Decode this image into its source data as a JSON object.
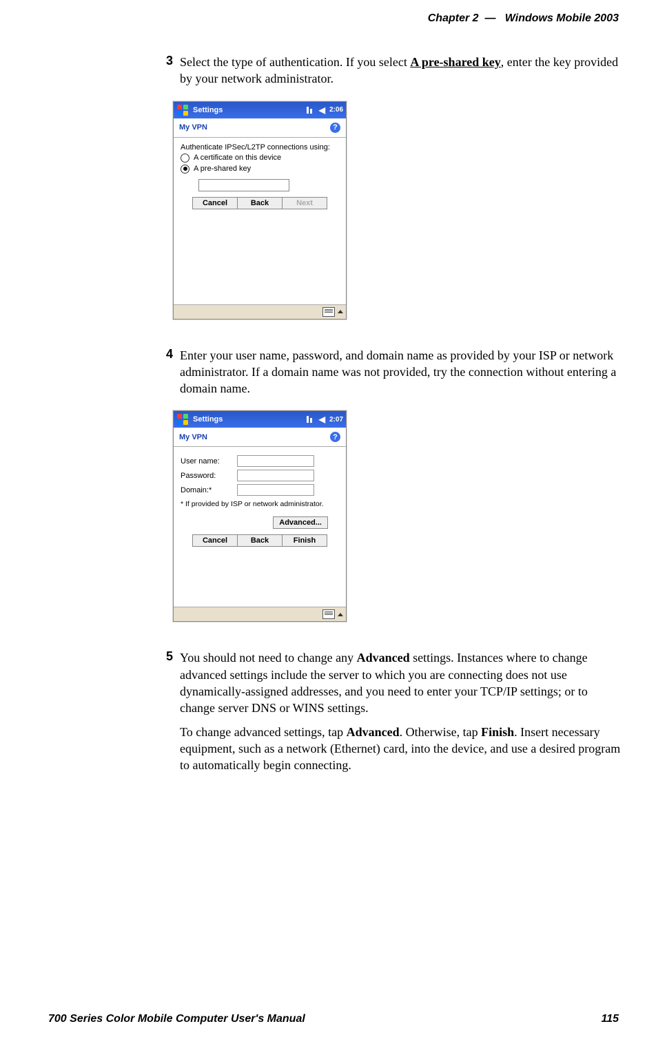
{
  "header": {
    "chapter": "Chapter",
    "chapter_num": "2",
    "dash": "—",
    "title": "Windows Mobile 2003"
  },
  "footer": {
    "manual": "700 Series Color Mobile Computer User's Manual",
    "page": "115"
  },
  "steps": {
    "s3": {
      "num": "3",
      "t1": "Select the type of authentication. If you select ",
      "bu1": "A pre-shared key",
      "t2": ", enter the key provided by your network administrator."
    },
    "s4": {
      "num": "4",
      "t1": "Enter your user name, password, and domain name as provided by your ISP or network administrator. If a domain name was not provided, try the connection without entering a domain name."
    },
    "s5": {
      "num": "5",
      "p1a": "You should not need to change any ",
      "p1b": "Advanced",
      "p1c": " settings. Instances where to change advanced settings include the server to which you are connecting does not use dynamically-assigned addresses, and you need to enter your TCP/IP settings; or to change server DNS or WINS settings.",
      "p2a": "To change advanced settings, tap ",
      "p2b": "Advanced",
      "p2c": ". Otherwise, tap ",
      "p2d": "Finish",
      "p2e": ". Insert necessary equipment, such as a network (Ethernet) card, into the device, and use a desired program to automatically begin connecting."
    }
  },
  "shot1": {
    "title": "Settings",
    "time": "2:06",
    "sub": "My VPN",
    "help": "?",
    "prompt": "Authenticate IPSec/L2TP connections using:",
    "opt1": "A certificate on this device",
    "opt2": "A pre-shared key",
    "btn_cancel": "Cancel",
    "btn_back": "Back",
    "btn_next": "Next"
  },
  "shot2": {
    "title": "Settings",
    "time": "2:07",
    "sub": "My VPN",
    "help": "?",
    "lbl_user": "User name:",
    "lbl_pass": "Password:",
    "lbl_domain": "Domain:*",
    "note": "* If provided by ISP or network administrator.",
    "btn_adv": "Advanced...",
    "btn_cancel": "Cancel",
    "btn_back": "Back",
    "btn_finish": "Finish"
  }
}
